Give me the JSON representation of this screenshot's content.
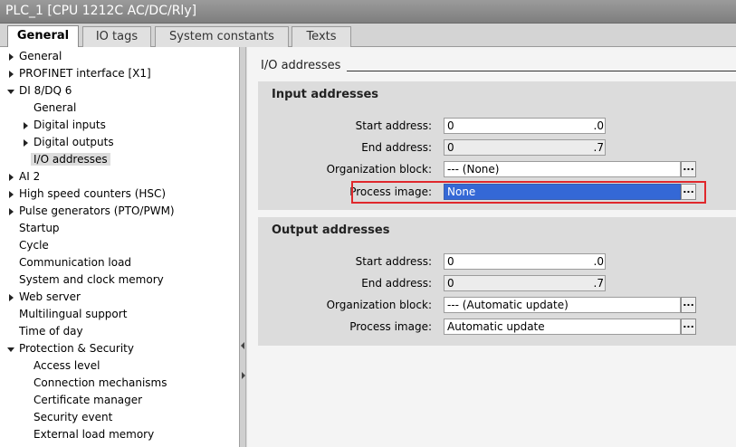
{
  "window": {
    "title": "PLC_1 [CPU 1212C AC/DC/Rly]"
  },
  "tabs": [
    {
      "label": "General",
      "active": true
    },
    {
      "label": "IO tags",
      "active": false
    },
    {
      "label": "System constants",
      "active": false
    },
    {
      "label": "Texts",
      "active": false
    }
  ],
  "nav": [
    {
      "label": "General",
      "arrow": "right"
    },
    {
      "label": "PROFINET interface [X1]",
      "arrow": "right"
    },
    {
      "label": "DI 8/DQ 6",
      "arrow": "down"
    },
    {
      "label": "General",
      "arrow": "none"
    },
    {
      "label": "Digital inputs",
      "arrow": "right"
    },
    {
      "label": "Digital outputs",
      "arrow": "right"
    },
    {
      "label": "I/O addresses",
      "arrow": "none",
      "selected": true
    },
    {
      "label": "AI 2",
      "arrow": "right"
    },
    {
      "label": "High speed counters (HSC)",
      "arrow": "right"
    },
    {
      "label": "Pulse generators (PTO/PWM)",
      "arrow": "right"
    },
    {
      "label": "Startup",
      "arrow": "none"
    },
    {
      "label": "Cycle",
      "arrow": "none"
    },
    {
      "label": "Communication load",
      "arrow": "none"
    },
    {
      "label": "System and clock memory",
      "arrow": "none"
    },
    {
      "label": "Web server",
      "arrow": "right"
    },
    {
      "label": "Multilingual support",
      "arrow": "none"
    },
    {
      "label": "Time of day",
      "arrow": "none"
    },
    {
      "label": "Protection & Security",
      "arrow": "down"
    },
    {
      "label": "Access level",
      "arrow": "none"
    },
    {
      "label": "Connection mechanisms",
      "arrow": "none"
    },
    {
      "label": "Certificate manager",
      "arrow": "none"
    },
    {
      "label": "Security event",
      "arrow": "none"
    },
    {
      "label": "External load memory",
      "arrow": "none"
    }
  ],
  "content": {
    "section_title": "I/O addresses",
    "input": {
      "title": "Input addresses",
      "start_label": "Start address:",
      "start_value": "0",
      "start_suffix": ".0",
      "end_label": "End address:",
      "end_value": "0",
      "end_suffix": ".7",
      "ob_label": "Organization block:",
      "ob_value": "--- (None)",
      "pi_label": "Process image:",
      "pi_value": "None"
    },
    "output": {
      "title": "Output addresses",
      "start_label": "Start address:",
      "start_value": "0",
      "start_suffix": ".0",
      "end_label": "End address:",
      "end_value": "0",
      "end_suffix": ".7",
      "ob_label": "Organization block:",
      "ob_value": "--- (Automatic update)",
      "pi_label": "Process image:",
      "pi_value": "Automatic update"
    },
    "dots_label": "...",
    "highlight_color": "#e0282c",
    "selection_color": "#3468d6"
  }
}
